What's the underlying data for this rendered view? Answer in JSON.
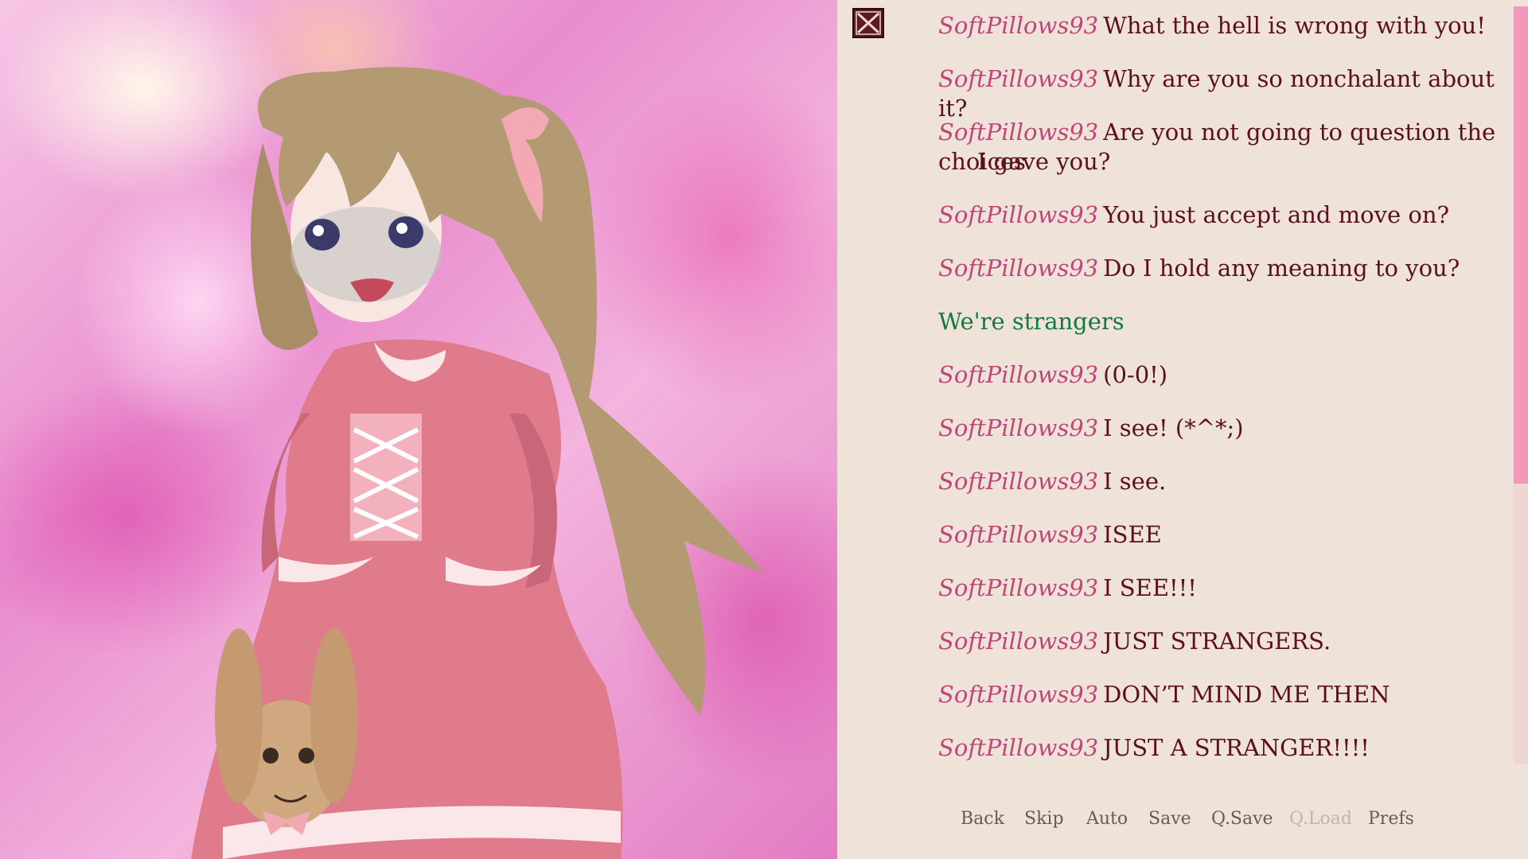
{
  "history": [
    {
      "who": "SoftPillows93",
      "text": "What the hell is wrong with you!"
    },
    {
      "who": "SoftPillows93",
      "text": "Why are you so nonchalant about it?"
    },
    {
      "who": "SoftPillows93",
      "text": "Are you not going to question the choices",
      "cont": "I gave you?"
    },
    {
      "who": "SoftPillows93",
      "text": "You just accept and move on?"
    },
    {
      "who": "SoftPillows93",
      "text": "Do I hold any meaning to you?"
    },
    {
      "choice": "We're strangers"
    },
    {
      "who": "SoftPillows93",
      "text": "(0-0!)"
    },
    {
      "who": "SoftPillows93",
      "text": "I see! (*^*;)"
    },
    {
      "who": "SoftPillows93",
      "text": "I see."
    },
    {
      "who": "SoftPillows93",
      "text": "ISEE"
    },
    {
      "who": "SoftPillows93",
      "text": "I SEE!!!"
    },
    {
      "who": "SoftPillows93",
      "text": "JUST STRANGERS."
    },
    {
      "who": "SoftPillows93",
      "text": "DON’T MIND ME THEN"
    },
    {
      "who": "SoftPillows93",
      "text": "JUST A STRANGER!!!!"
    }
  ],
  "menu": {
    "back": "Back",
    "skip": "Skip",
    "auto": "Auto",
    "save": "Save",
    "qsave": "Q.Save",
    "qload": "Q.Load",
    "prefs": "Prefs"
  },
  "colors": {
    "name": "#c0457a",
    "text": "#5b0f1f",
    "choice": "#137a3e",
    "panel": "#efe2d8",
    "scroll_thumb": "#f398ba"
  },
  "icons": {
    "close": "close-icon"
  }
}
